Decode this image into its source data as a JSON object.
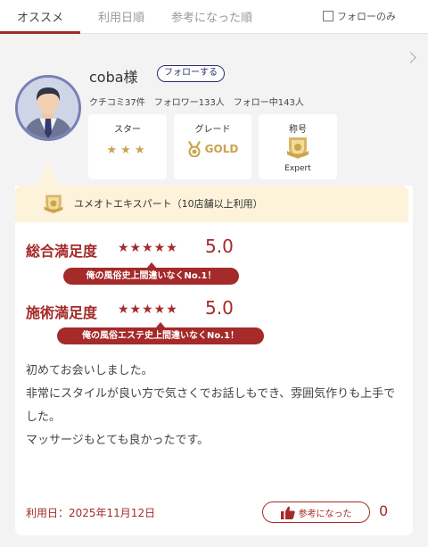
{
  "tabs": [
    {
      "label": "オススメ",
      "active": true
    },
    {
      "label": "利用日順",
      "active": false
    },
    {
      "label": "参考になった順",
      "active": false
    }
  ],
  "follow_only": {
    "label": "フォローのみ",
    "checked": false
  },
  "review": {
    "user": {
      "name": "coba様",
      "follow_button": "フォローする",
      "stats": "クチコミ37件　フォロワー133人　フォロー中143人"
    },
    "badges": {
      "star_title": "スター",
      "star_count": 3,
      "star_glyphs": "★★★",
      "grade_title": "グレード",
      "grade_value": "GOLD",
      "title_title": "称号",
      "title_value": "Expert"
    },
    "expert_banner": "ユメオトエキスパート（10店舗以上利用）",
    "ratings": [
      {
        "label": "総合満足度",
        "stars": "★★★★★",
        "score": "5.0",
        "comment": "俺の風俗史上間違いなくNo.1！"
      },
      {
        "label": "施術満足度",
        "stars": "★★★★★",
        "score": "5.0",
        "comment": "俺の風俗エステ史上間違いなくNo.1！"
      }
    ],
    "body": [
      "初めてお会いしました。",
      "非常にスタイルが良い方で気さくでお話しもでき、雰囲気作りも上手でした。",
      "マッサージもとても良かったです。"
    ],
    "visit_date": "利用日：2025年11月12日",
    "helpful_label": "参考になった",
    "helpful_count": "0"
  },
  "colors": {
    "accent": "#a52a2a",
    "gold": "#c9a54c",
    "navy": "#2d2e6b",
    "banner": "#fdf2da"
  },
  "icons": [
    "chevron-right-icon",
    "avatar-businessman",
    "medal-icon",
    "expert-badge-icon",
    "thumbs-up-icon"
  ]
}
